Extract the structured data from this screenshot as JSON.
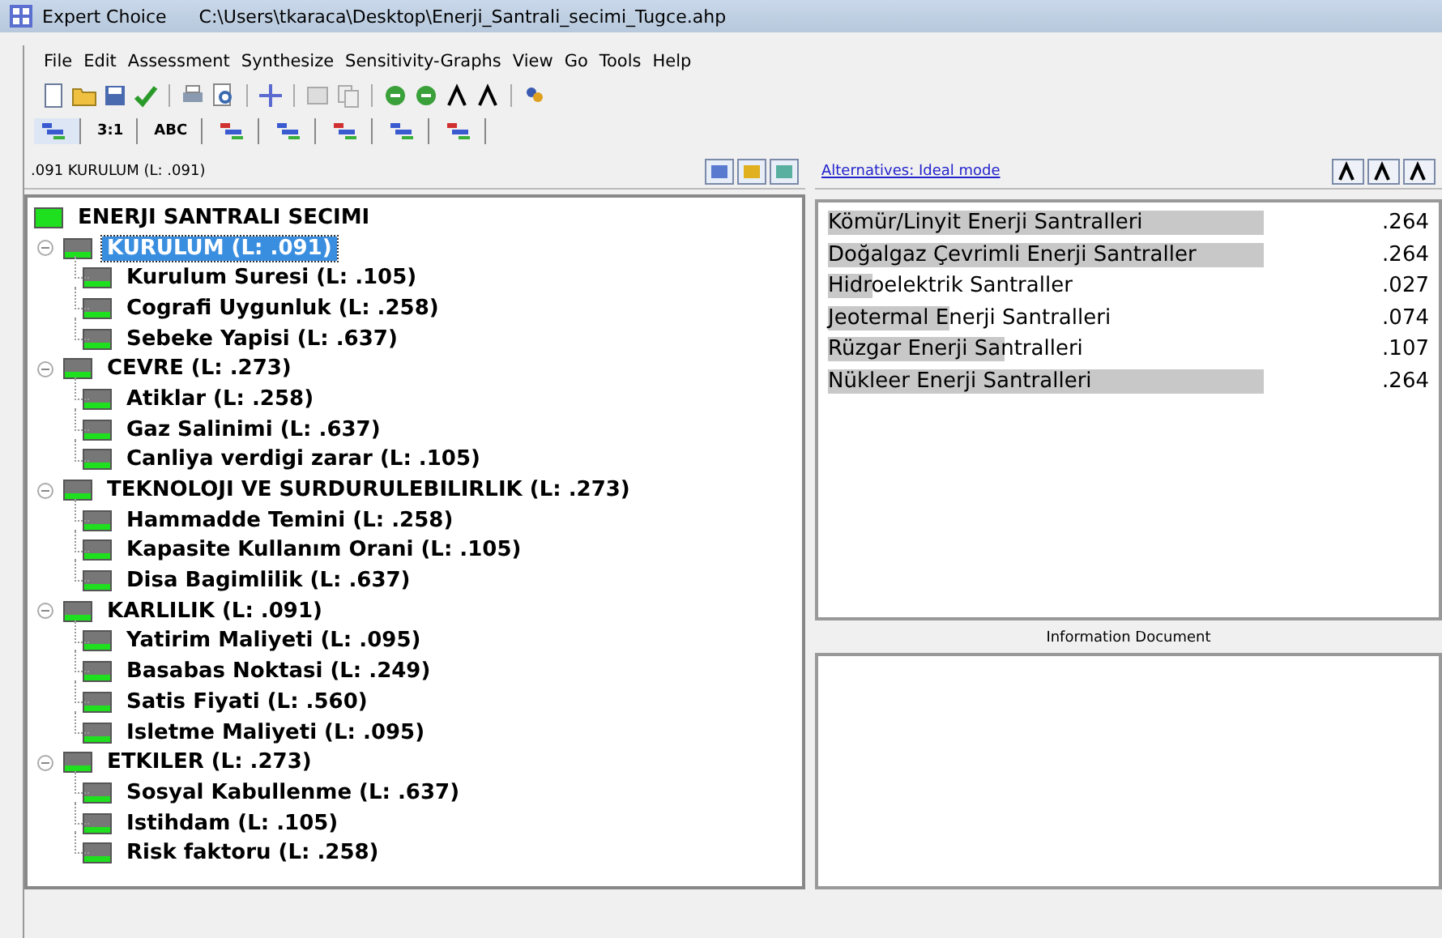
{
  "window": {
    "app": "Expert Choice",
    "path": "C:\\Users\\tkaraca\\Desktop\\Enerji_Santrali_secimi_Tugce.ahp"
  },
  "menu": [
    "File",
    "Edit",
    "Assessment",
    "Synthesize",
    "Sensitivity-Graphs",
    "View",
    "Go",
    "Tools",
    "Help"
  ],
  "tabs": [
    {
      "kind": "icon",
      "selected": true
    },
    {
      "kind": "text",
      "label": "3:1",
      "selected": false
    },
    {
      "kind": "text",
      "label": "ABC",
      "selected": false
    },
    {
      "kind": "icon",
      "selected": false
    },
    {
      "kind": "icon",
      "selected": false
    },
    {
      "kind": "icon",
      "selected": false
    },
    {
      "kind": "icon",
      "selected": false
    },
    {
      "kind": "icon",
      "selected": false
    }
  ],
  "tree_header": ".091  KURULUM (L: .091)",
  "tree": {
    "label": "ENERJI SANTRALI SECIMI",
    "selected": false,
    "children": [
      {
        "label": "KURULUM (L: .091)",
        "selected": true,
        "expanded": true,
        "children": [
          {
            "label": "Kurulum Suresi (L: .105)",
            "selected": false
          },
          {
            "label": "Cografi Uygunluk (L: .258)",
            "selected": false
          },
          {
            "label": "Sebeke Yapisi (L: .637)",
            "selected": false
          }
        ]
      },
      {
        "label": "CEVRE (L: .273)",
        "selected": false,
        "expanded": true,
        "children": [
          {
            "label": "Atiklar (L: .258)",
            "selected": false
          },
          {
            "label": "Gaz Salinimi (L: .637)",
            "selected": false
          },
          {
            "label": "Canliya verdigi zarar (L: .105)",
            "selected": false
          }
        ]
      },
      {
        "label": "TEKNOLOJI VE SURDURULEBILIRLIK (L: .273)",
        "selected": false,
        "expanded": true,
        "children": [
          {
            "label": "Hammadde Temini (L: .258)",
            "selected": false
          },
          {
            "label": "Kapasite Kullanım Orani (L: .105)",
            "selected": false
          },
          {
            "label": "Disa Bagimlilik (L: .637)",
            "selected": false
          }
        ]
      },
      {
        "label": "KARLILIK (L: .091)",
        "selected": false,
        "expanded": true,
        "children": [
          {
            "label": "Yatirim Maliyeti (L: .095)",
            "selected": false
          },
          {
            "label": "Basabas Noktasi (L: .249)",
            "selected": false
          },
          {
            "label": "Satis Fiyati (L: .560)",
            "selected": false
          },
          {
            "label": "Isletme Maliyeti (L: .095)",
            "selected": false
          }
        ]
      },
      {
        "label": "ETKILER (L: .273)",
        "selected": false,
        "expanded": true,
        "children": [
          {
            "label": "Sosyal Kabullenme (L: .637)",
            "selected": false
          },
          {
            "label": "Istihdam (L: .105)",
            "selected": false
          },
          {
            "label": "Risk faktoru (L: .258)",
            "selected": false
          }
        ]
      }
    ]
  },
  "alternatives_link": "Alternatives: Ideal mode",
  "alternatives": [
    {
      "name": "Kömür/Linyit Enerji Santralleri",
      "value": ".264"
    },
    {
      "name": "Doğalgaz Çevrimli Enerji Santraller",
      "value": ".264"
    },
    {
      "name": "Hidroelektrik Santraller",
      "value": ".027"
    },
    {
      "name": "Jeotermal Enerji Santralleri",
      "value": ".074"
    },
    {
      "name": "Rüzgar Enerji Santralleri",
      "value": ".107"
    },
    {
      "name": "Nükleer Enerji Santralleri",
      "value": ".264"
    }
  ],
  "info_title": "Information Document"
}
